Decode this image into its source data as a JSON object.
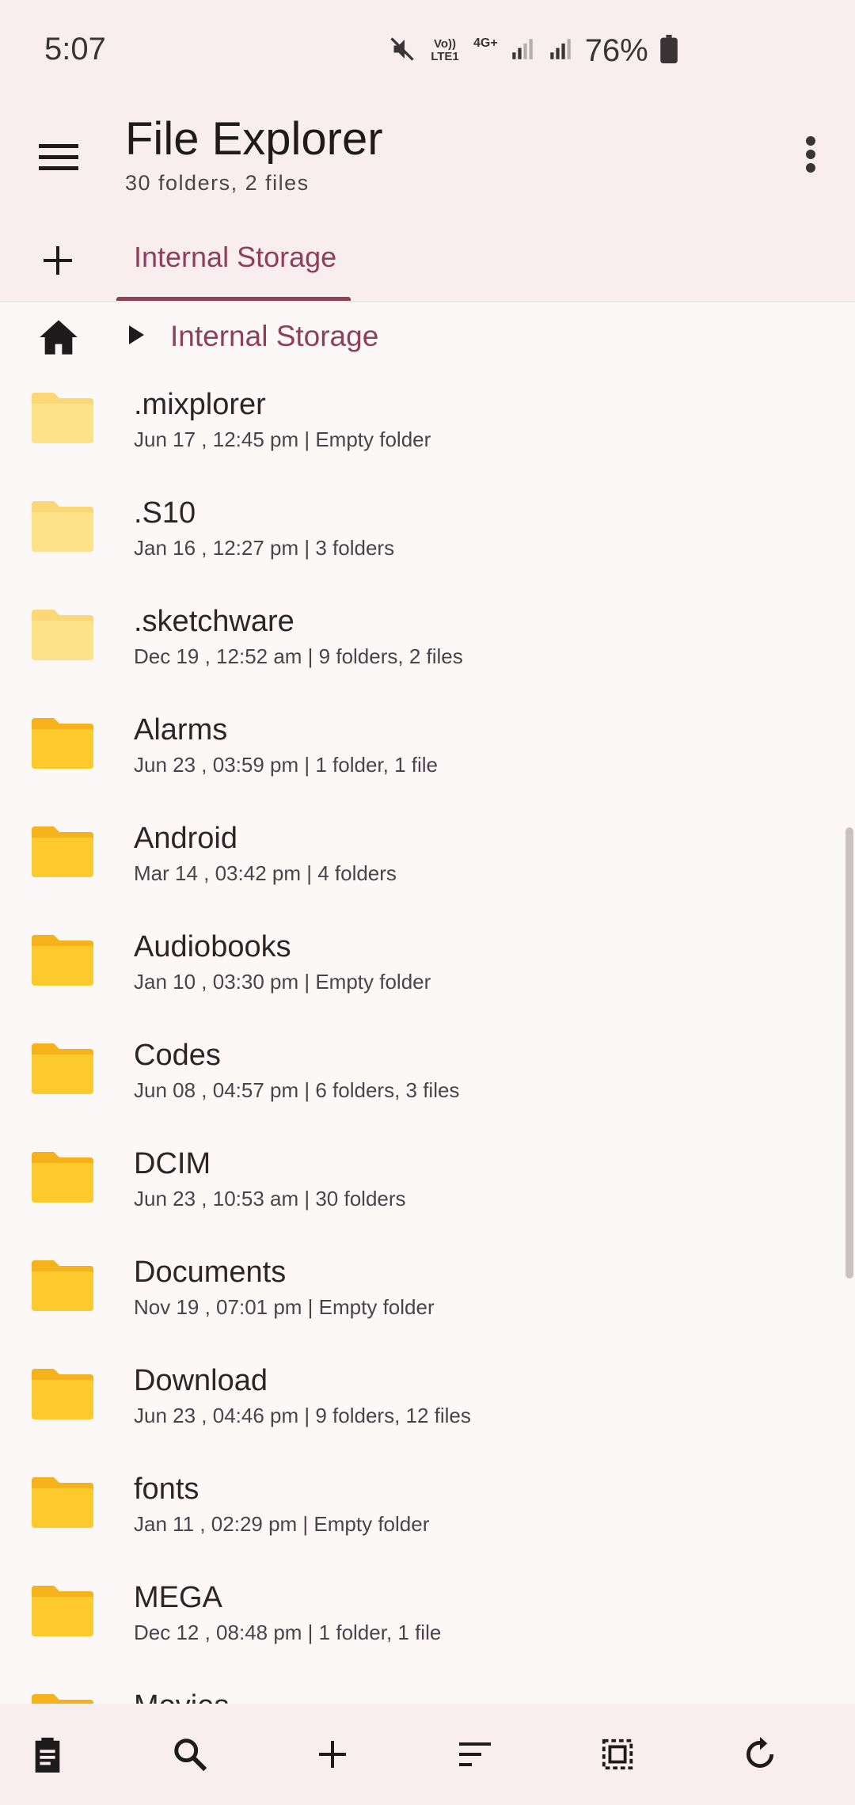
{
  "status": {
    "time": "5:07",
    "battery": "76%",
    "volte": "Vo)) LTE1",
    "network": "4G+"
  },
  "app": {
    "title": "File Explorer",
    "subtitle": "30 folders, 2 files"
  },
  "tabs": [
    {
      "label": "Internal Storage"
    }
  ],
  "breadcrumb": {
    "path": "Internal Storage"
  },
  "files": [
    {
      "name": ".mixplorer",
      "meta": "Jun 17 , 12:45 pm  |  Empty folder",
      "hidden": true
    },
    {
      "name": ".S10",
      "meta": "Jan 16 , 12:27 pm  |  3 folders",
      "hidden": true
    },
    {
      "name": ".sketchware",
      "meta": "Dec 19 , 12:52 am  |  9 folders, 2 files",
      "hidden": true
    },
    {
      "name": "Alarms",
      "meta": "Jun 23 , 03:59 pm  |  1 folder, 1 file",
      "hidden": false
    },
    {
      "name": "Android",
      "meta": "Mar 14 , 03:42 pm  |  4 folders",
      "hidden": false
    },
    {
      "name": "Audiobooks",
      "meta": "Jan 10 , 03:30 pm  |  Empty folder",
      "hidden": false
    },
    {
      "name": "Codes",
      "meta": "Jun 08 , 04:57 pm  |  6 folders, 3 files",
      "hidden": false
    },
    {
      "name": "DCIM",
      "meta": "Jun 23 , 10:53 am  |  30 folders",
      "hidden": false
    },
    {
      "name": "Documents",
      "meta": "Nov 19 , 07:01 pm  |  Empty folder",
      "hidden": false
    },
    {
      "name": "Download",
      "meta": "Jun 23 , 04:46 pm  |  9 folders, 12 files",
      "hidden": false
    },
    {
      "name": "fonts",
      "meta": "Jan 11 , 02:29 pm  |  Empty folder",
      "hidden": false
    },
    {
      "name": "MEGA",
      "meta": "Dec 12 , 08:48 pm  |  1 folder, 1 file",
      "hidden": false
    },
    {
      "name": "Movies",
      "meta": "",
      "hidden": false
    }
  ],
  "bottom_actions": [
    {
      "name": "clipboard-button",
      "icon": "clipboard-icon"
    },
    {
      "name": "search-button",
      "icon": "search-icon"
    },
    {
      "name": "new-item-button",
      "icon": "plus-icon"
    },
    {
      "name": "sort-button",
      "icon": "sort-icon"
    },
    {
      "name": "select-all-button",
      "icon": "select-all-icon"
    },
    {
      "name": "refresh-button",
      "icon": "refresh-icon"
    }
  ],
  "colors": {
    "accent": "#8e3f5c",
    "folder": "#fdca2d",
    "folder_back": "#f6b21a",
    "hidden_folder": "#fde28a",
    "hidden_folder_back": "#fbd777",
    "surface": "#f8eef0",
    "background": "#fdf8f8"
  }
}
